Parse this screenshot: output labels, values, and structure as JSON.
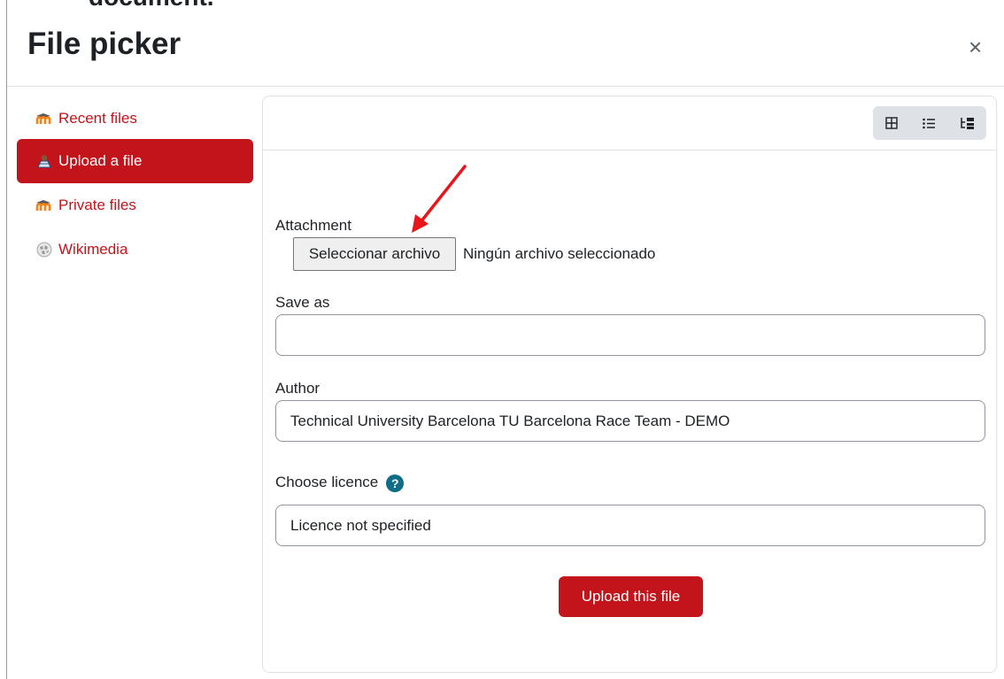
{
  "page": {
    "cut_off_text": "document.",
    "title": "File picker",
    "close_symbol": "×"
  },
  "sidebar": {
    "items": [
      {
        "label": "Recent files",
        "icon": "moodle-icon",
        "active": false
      },
      {
        "label": "Upload a file",
        "icon": "upload-icon",
        "active": true
      },
      {
        "label": "Private files",
        "icon": "moodle-icon",
        "active": false
      },
      {
        "label": "Wikimedia",
        "icon": "wikimedia-icon",
        "active": false
      }
    ]
  },
  "toolbar": {
    "views": [
      "grid-view-icon",
      "list-view-icon",
      "tree-view-icon"
    ]
  },
  "form": {
    "attachment_label": "Attachment",
    "select_button_label": "Seleccionar archivo",
    "file_status": "Ningún archivo seleccionado",
    "save_as_label": "Save as",
    "save_as_value": "",
    "author_label": "Author",
    "author_value": "Technical University Barcelona TU Barcelona Race Team - DEMO",
    "licence_label": "Choose licence",
    "licence_help": "?",
    "licence_value": "Licence not specified",
    "upload_button_label": "Upload this file"
  },
  "colors": {
    "brand": "#c4141b",
    "help": "#0f6d87",
    "annotation_arrow": "#e8161a"
  }
}
